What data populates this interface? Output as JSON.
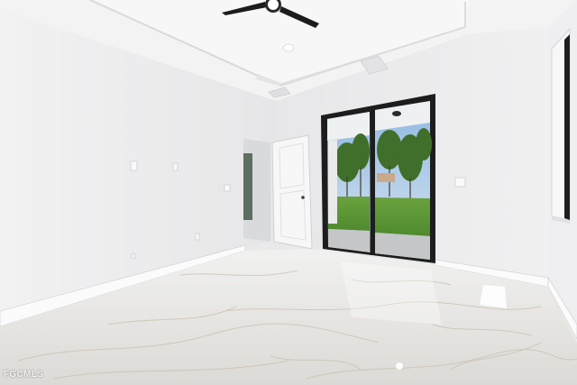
{
  "photo": {
    "subject": "empty-room-with-sliding-glass-door",
    "watermark": "FGCMLS"
  },
  "palette": {
    "wall": "#f1f1f2",
    "ceiling": "#f5f5f6",
    "floor": "#e2e1df",
    "door_frame": "#1c1c1c",
    "lawn": "#5f9a3a",
    "trees": "#3f6f2a",
    "sky": "#9cc3e8"
  }
}
